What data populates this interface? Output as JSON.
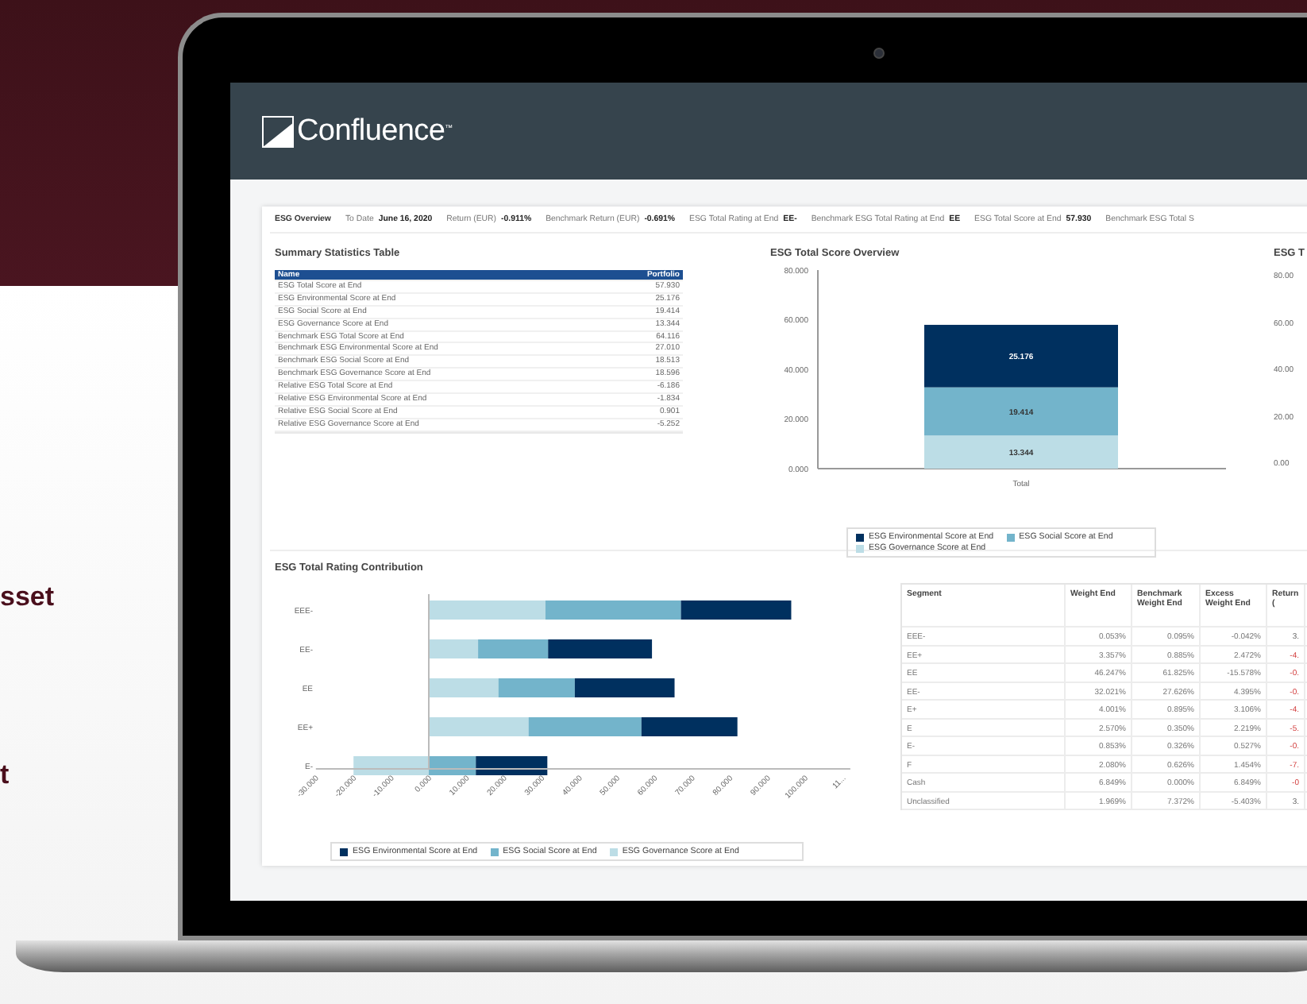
{
  "background_text": [
    "sset",
    "t"
  ],
  "logo": {
    "text": "Confluence",
    "mark": "™"
  },
  "info_bar": [
    {
      "kind": "title",
      "label": "ESG Overview"
    },
    {
      "kind": "pair",
      "label": "To Date",
      "value": "June 16, 2020"
    },
    {
      "kind": "pair",
      "label": "Return (EUR)",
      "value": "-0.911%"
    },
    {
      "kind": "pair",
      "label": "Benchmark Return (EUR)",
      "value": "-0.691%"
    },
    {
      "kind": "pair",
      "label": "ESG Total Rating at End",
      "value": "EE-"
    },
    {
      "kind": "pair",
      "label": "Benchmark ESG Total Rating at End",
      "value": "EE"
    },
    {
      "kind": "pair",
      "label": "ESG Total Score at End",
      "value": "57.930"
    },
    {
      "kind": "label",
      "label": "Benchmark ESG Total S"
    }
  ],
  "summary_table": {
    "title": "Summary Statistics Table",
    "columns": [
      "Name",
      "Portfolio"
    ],
    "rows": [
      [
        "ESG Total Score at End",
        "57.930"
      ],
      [
        "ESG Environmental Score at End",
        "25.176"
      ],
      [
        "ESG Social Score at End",
        "19.414"
      ],
      [
        "ESG Governance Score at End",
        "13.344"
      ],
      [
        "Benchmark ESG Total Score at End",
        "64.116"
      ],
      [
        "Benchmark ESG Environmental Score at End",
        "27.010"
      ],
      [
        "Benchmark ESG Social Score at End",
        "18.513"
      ],
      [
        "Benchmark ESG Governance Score at End",
        "18.596"
      ],
      [
        "Relative ESG Total Score at End",
        "-6.186"
      ],
      [
        "Relative ESG Environmental Score at End",
        "-1.834"
      ],
      [
        "Relative ESG Social Score at End",
        "0.901"
      ],
      [
        "Relative ESG Governance Score at End",
        "-5.252"
      ]
    ]
  },
  "score_overview": {
    "chart_data": {
      "type": "bar",
      "title": "ESG Total Score Overview",
      "stacked": true,
      "legend": "bottom",
      "data_labels": true,
      "categories": [
        "Total"
      ],
      "ylim": [
        0,
        80
      ],
      "yticks": [
        {
          "value": 80,
          "label": "80.000"
        },
        {
          "value": 60,
          "label": "60.000"
        },
        {
          "value": 40,
          "label": "40.000"
        },
        {
          "value": 20,
          "label": "20.000"
        },
        {
          "value": 0,
          "label": "0.000"
        }
      ],
      "series": [
        {
          "name": "ESG Environmental Score at End",
          "color": "#00305f",
          "values": [
            25.176
          ]
        },
        {
          "name": "ESG Social Score at End",
          "color": "#73b4cb",
          "values": [
            19.414
          ]
        },
        {
          "name": "ESG Governance Score at End",
          "color": "#bcdde6",
          "values": [
            13.344
          ]
        }
      ]
    }
  },
  "third_chart": {
    "title": "ESG T",
    "axis_labels": [
      "80.00",
      "60.00",
      "40.00",
      "20.00",
      "0.00"
    ]
  },
  "rating_contribution": {
    "chart_data": {
      "type": "bar",
      "orientation": "horizontal",
      "stacked": true,
      "legend": "bottom",
      "title": "ESG Total Rating Contribution",
      "categories": [
        "EEE-",
        "EE-",
        "EE",
        "EE+",
        "E-"
      ],
      "xlim": [
        -30,
        112
      ],
      "xticks": [
        {
          "value": -30,
          "label": "-30.000"
        },
        {
          "value": -20,
          "label": "-20.000"
        },
        {
          "value": -10,
          "label": "-10.000"
        },
        {
          "value": 0,
          "label": "0.000"
        },
        {
          "value": 10,
          "label": "10.000"
        },
        {
          "value": 20,
          "label": "20.000"
        },
        {
          "value": 30,
          "label": "30.000"
        },
        {
          "value": 40,
          "label": "40.000"
        },
        {
          "value": 50,
          "label": "50.000"
        },
        {
          "value": 60,
          "label": "60.000"
        },
        {
          "value": 70,
          "label": "70.000"
        },
        {
          "value": 80,
          "label": "80.000"
        },
        {
          "value": 90,
          "label": "90.000"
        },
        {
          "value": 100,
          "label": "100.000"
        },
        {
          "value": 110,
          "label": "11..."
        }
      ],
      "series": [
        {
          "name": "ESG Environmental Score at End",
          "color": "#00305f",
          "values": [
            29.3,
            27.6,
            26.5,
            25.5,
            19.0
          ]
        },
        {
          "name": "ESG Social Score at End",
          "color": "#73b4cb",
          "values": [
            36.0,
            18.6,
            20.3,
            30.0,
            12.5
          ]
        },
        {
          "name": "ESG Governance Score at End",
          "color": "#bcdde6",
          "values": [
            31.0,
            13.1,
            18.5,
            26.5,
            -20.0
          ]
        }
      ]
    }
  },
  "segment_table": {
    "columns": [
      "Segment",
      "Weight End",
      "Benchmark Weight End",
      "Excess Weight End",
      "Return ("
    ],
    "rows": [
      {
        "cells": [
          "EEE-",
          "0.053%",
          "0.095%",
          "-0.042%",
          "3."
        ],
        "negative": false
      },
      {
        "cells": [
          "EE+",
          "3.357%",
          "0.885%",
          "2.472%",
          "-4."
        ],
        "negative": true
      },
      {
        "cells": [
          "EE",
          "46.247%",
          "61.825%",
          "-15.578%",
          "-0."
        ],
        "negative": true
      },
      {
        "cells": [
          "EE-",
          "32.021%",
          "27.626%",
          "4.395%",
          "-0."
        ],
        "negative": true
      },
      {
        "cells": [
          "E+",
          "4.001%",
          "0.895%",
          "3.106%",
          "-4."
        ],
        "negative": true
      },
      {
        "cells": [
          "E",
          "2.570%",
          "0.350%",
          "2.219%",
          "-5."
        ],
        "negative": true
      },
      {
        "cells": [
          "E-",
          "0.853%",
          "0.326%",
          "0.527%",
          "-0."
        ],
        "negative": true
      },
      {
        "cells": [
          "F",
          "2.080%",
          "0.626%",
          "1.454%",
          "-7."
        ],
        "negative": true
      },
      {
        "cells": [
          "Cash",
          "6.849%",
          "0.000%",
          "6.849%",
          "-0"
        ],
        "negative": true
      },
      {
        "cells": [
          "Unclassified",
          "1.969%",
          "7.372%",
          "-5.403%",
          "3."
        ],
        "negative": false
      }
    ]
  }
}
